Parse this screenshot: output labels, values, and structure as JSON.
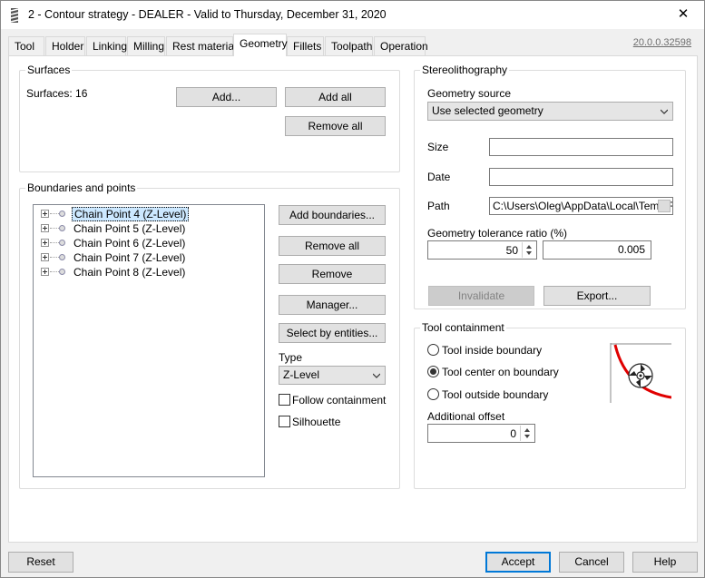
{
  "window": {
    "title": "2 - Contour strategy - DEALER - Valid to Thursday, December 31, 2020",
    "close_label": "✕"
  },
  "tabs": [
    {
      "label": "Tool"
    },
    {
      "label": "Holder"
    },
    {
      "label": "Linking"
    },
    {
      "label": "Milling"
    },
    {
      "label": "Rest material"
    },
    {
      "label": "Geometry"
    },
    {
      "label": "Fillets"
    },
    {
      "label": "Toolpath"
    },
    {
      "label": "Operation"
    }
  ],
  "active_tab": "Geometry",
  "version": "20.0.0.32598",
  "surfaces": {
    "title": "Surfaces",
    "count_label": "Surfaces: 16",
    "add_button": "Add...",
    "add_all_button": "Add all",
    "remove_all_button": "Remove all"
  },
  "boundaries": {
    "title": "Boundaries and points",
    "items": [
      {
        "label": "Chain Point 4 (Z-Level)",
        "selected": true
      },
      {
        "label": "Chain Point 5 (Z-Level)",
        "selected": false
      },
      {
        "label": "Chain Point 6 (Z-Level)",
        "selected": false
      },
      {
        "label": "Chain Point 7 (Z-Level)",
        "selected": false
      },
      {
        "label": "Chain Point 8 (Z-Level)",
        "selected": false
      }
    ],
    "add_boundaries_button": "Add boundaries...",
    "remove_all_button": "Remove all",
    "remove_button": "Remove",
    "manager_button": "Manager...",
    "select_by_entities_button": "Select by entities...",
    "type_label": "Type",
    "type_value": "Z-Level",
    "follow_containment_label": "Follow containment",
    "follow_containment_checked": false,
    "silhouette_label": "Silhouette",
    "silhouette_checked": false
  },
  "stereolithography": {
    "title": "Stereolithography",
    "geometry_source_label": "Geometry source",
    "geometry_source_value": "Use selected geometry",
    "size_label": "Size",
    "size_value": "",
    "date_label": "Date",
    "date_value": "",
    "path_label": "Path",
    "path_value": "C:\\Users\\Oleg\\AppData\\Local\\Temp\\F",
    "tolerance_label": "Geometry tolerance ratio (%)",
    "tolerance_ratio": "50",
    "tolerance_value": "0.005",
    "invalidate_button": "Invalidate",
    "export_button": "Export..."
  },
  "tool_containment": {
    "title": "Tool containment",
    "options": [
      {
        "label": "Tool inside boundary",
        "checked": false
      },
      {
        "label": "Tool center on boundary",
        "checked": true
      },
      {
        "label": "Tool outside boundary",
        "checked": false
      }
    ],
    "additional_offset_label": "Additional offset",
    "additional_offset_value": "0",
    "accent_color": "#e00000"
  },
  "footer": {
    "reset_button": "Reset",
    "accept_button": "Accept",
    "cancel_button": "Cancel",
    "help_button": "Help"
  },
  "colors": {
    "selection": "#cce8ff",
    "primary_border": "#0078d7"
  }
}
